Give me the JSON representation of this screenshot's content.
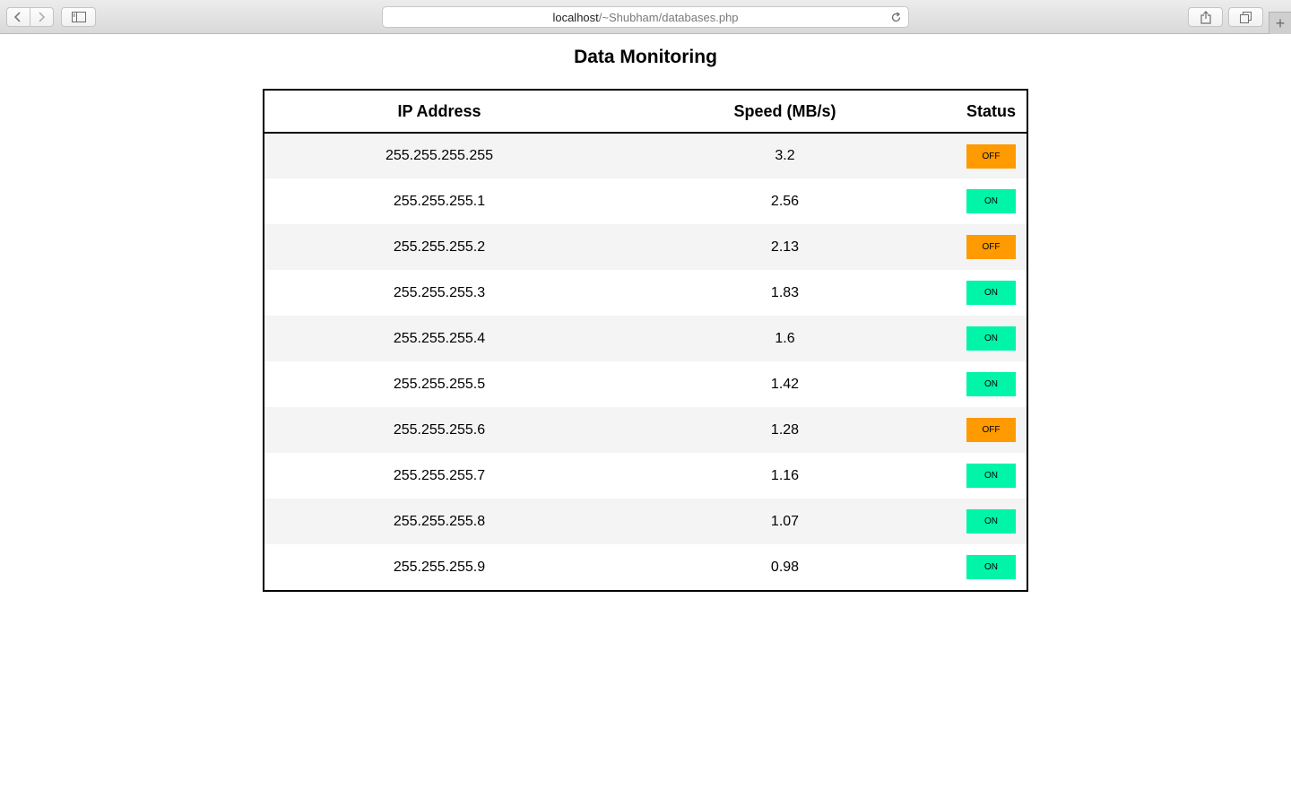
{
  "browser": {
    "url_host": "localhost",
    "url_path": "/~Shubham/databases.php",
    "icons": [
      "back-icon",
      "forward-icon",
      "sidebar-icon",
      "reload-icon",
      "share-icon",
      "tabs-icon",
      "plus-icon"
    ]
  },
  "page": {
    "title": "Data Monitoring"
  },
  "table": {
    "headers": [
      "IP Address",
      "Speed (MB/s)",
      "Status"
    ],
    "status_colors": {
      "ON": "#00f5a8",
      "OFF": "#ff9a00"
    },
    "rows": [
      {
        "ip": "255.255.255.255",
        "speed": "3.2",
        "status": "OFF"
      },
      {
        "ip": "255.255.255.1",
        "speed": "2.56",
        "status": "ON"
      },
      {
        "ip": "255.255.255.2",
        "speed": "2.13",
        "status": "OFF"
      },
      {
        "ip": "255.255.255.3",
        "speed": "1.83",
        "status": "ON"
      },
      {
        "ip": "255.255.255.4",
        "speed": "1.6",
        "status": "ON"
      },
      {
        "ip": "255.255.255.5",
        "speed": "1.42",
        "status": "ON"
      },
      {
        "ip": "255.255.255.6",
        "speed": "1.28",
        "status": "OFF"
      },
      {
        "ip": "255.255.255.7",
        "speed": "1.16",
        "status": "ON"
      },
      {
        "ip": "255.255.255.8",
        "speed": "1.07",
        "status": "ON"
      },
      {
        "ip": "255.255.255.9",
        "speed": "0.98",
        "status": "ON"
      }
    ]
  }
}
